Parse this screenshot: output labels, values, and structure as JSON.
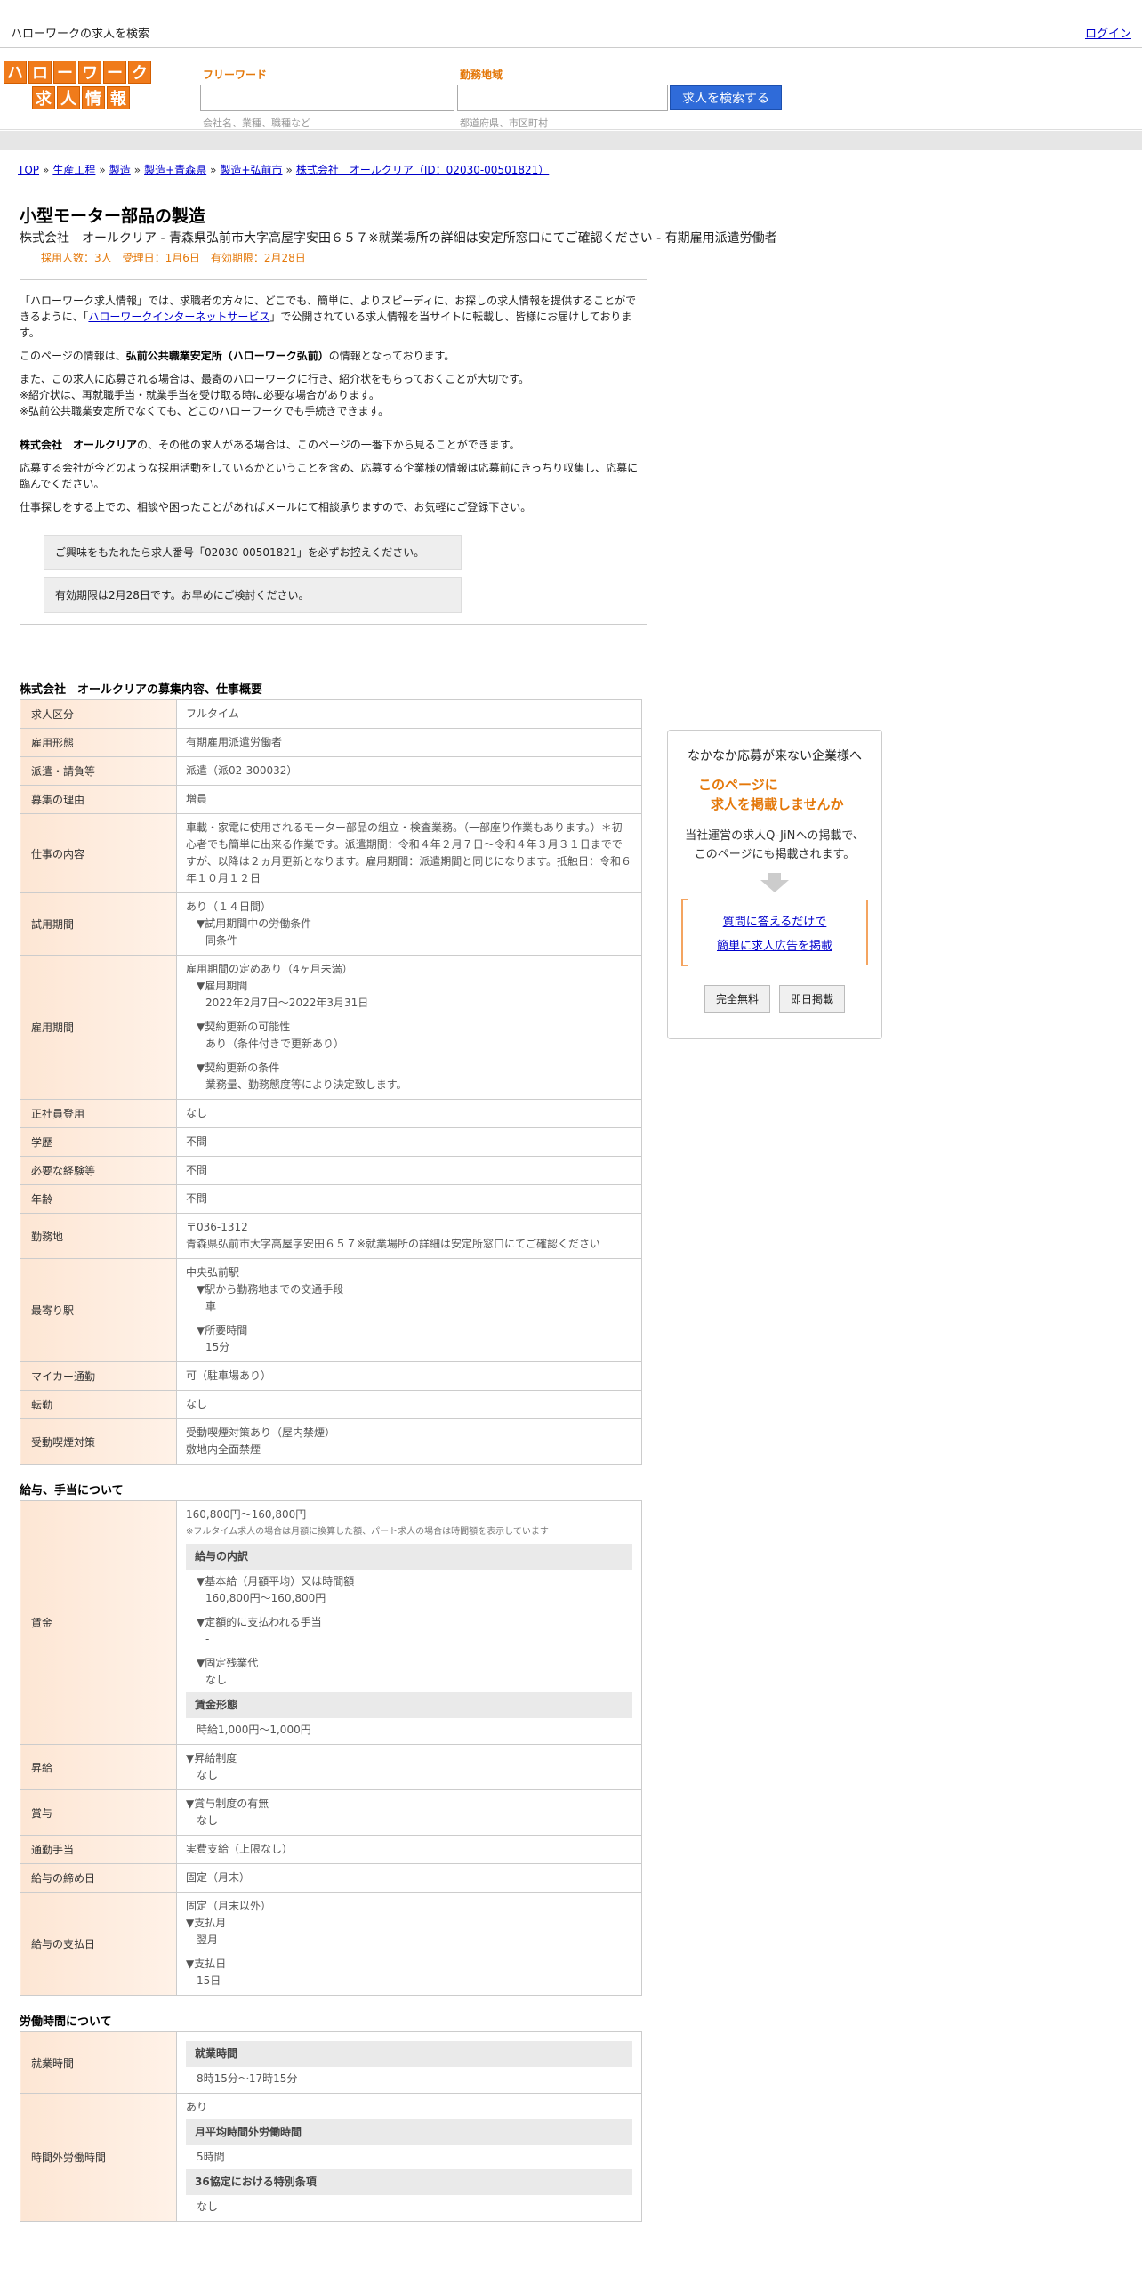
{
  "header": {
    "site_title": "ハローワークの求人を検索",
    "login": "ログイン"
  },
  "logo": {
    "row1": [
      "ハ",
      "ロ",
      "ー",
      "ワ",
      "ー",
      "ク"
    ],
    "row2": [
      "求",
      "人",
      "情",
      "報"
    ]
  },
  "search": {
    "freeword_label": "フリーワード",
    "freeword_value": "",
    "freeword_hint": "会社名、業種、職種など",
    "area_label": "勤務地域",
    "area_value": "",
    "area_hint": "都道府県、市区町村",
    "button": "求人を検索する"
  },
  "breadcrumb": [
    "TOP",
    "生産工程",
    "製造",
    "製造+青森県",
    "製造+弘前市",
    "株式会社　オールクリア（ID：02030-00501821）"
  ],
  "job": {
    "title": "小型モーター部品の製造",
    "company_line": "株式会社　オールクリア - 青森県弘前市大字高屋字安田６５７※就業場所の詳細は安定所窓口にてご確認ください - 有期雇用派遣労働者",
    "meta": "採用人数：3人　受理日：1月6日　有効期限：2月28日"
  },
  "intro": {
    "p1_a": "「ハローワーク求人情報」では、求職者の方々に、どこでも、簡単に、よりスピーディに、お探しの求人情報を提供することができるように、「",
    "p1_link": "ハローワークインターネットサービス",
    "p1_b": "」で公開されている求人情報を当サイトに転載し、皆様にお届けしております。",
    "p2_a": "このページの情報は、",
    "p2_bold": "弘前公共職業安定所（ハローワーク弘前）",
    "p2_b": "の情報となっております。",
    "p3_1": "また、この求人に応募される場合は、最寄のハローワークに行き、紹介状をもらっておくことが大切です。",
    "p3_2": "※紹介状は、再就職手当・就業手当を受け取る時に必要な場合があります。",
    "p3_3": "※弘前公共職業安定所でなくても、どこのハローワークでも手続きできます。",
    "p4_bold": "株式会社　オールクリア",
    "p4_b": "の、その他の求人がある場合は、このページの一番下から見ることができます。",
    "p5": "応募する会社が今どのような採用活動をしているかということを含め、応募する企業様の情報は応募前にきっちり収集し、応募に臨んでください。",
    "p6": "仕事探しをする上での、相談や困ったことがあればメールにて相談承りますので、お気軽にご登録下さい。"
  },
  "notices": [
    "ご興味をもたれたら求人番号「02030-00501821」を必ずお控えください。",
    "有効期限は2月28日です。お早めにご検討ください。"
  ],
  "section1": {
    "title": "株式会社　オールクリアの募集内容、仕事概要",
    "rows": [
      {
        "label": "求人区分",
        "value": "フルタイム"
      },
      {
        "label": "雇用形態",
        "value": "有期雇用派遣労働者"
      },
      {
        "label": "派遣・請負等",
        "value": "派遣（派02-300032）"
      },
      {
        "label": "募集の理由",
        "value": "増員"
      },
      {
        "label": "仕事の内容",
        "value": "車載・家電に使用されるモーター部品の組立・検査業務。（一部座り作業もあります。）＊初心者でも簡単に出来る作業です。派遣期間：令和４年２月７日～令和４年３月３１日までですが、以降は２ヵ月更新となります。雇用期間：派遣期間と同じになります。抵触日：令和６年１０月１２日"
      },
      {
        "label": "正社員登用",
        "value": "なし"
      },
      {
        "label": "学歴",
        "value": "不問"
      },
      {
        "label": "必要な経験等",
        "value": "不問"
      },
      {
        "label": "年齢",
        "value": "不問"
      },
      {
        "label": "マイカー通勤",
        "value": "可（駐車場あり）"
      },
      {
        "label": "転勤",
        "value": "なし"
      }
    ],
    "trial": {
      "label": "試用期間",
      "v1": "あり（１４日間）",
      "v2": "▼試用期間中の労働条件",
      "v3": "同条件"
    },
    "period": {
      "label": "雇用期間",
      "v1": "雇用期間の定めあり（4ヶ月未満）",
      "v2": "▼雇用期間",
      "v3": "2022年2月7日〜2022年3月31日",
      "v4": "▼契約更新の可能性",
      "v5": "あり（条件付きで更新あり）",
      "v6": "▼契約更新の条件",
      "v7": "業務量、勤務態度等により決定致します。"
    },
    "location": {
      "label": "勤務地",
      "v1": "〒036-1312",
      "v2": "青森県弘前市大字高屋字安田６５７※就業場所の詳細は安定所窓口にてご確認ください"
    },
    "station": {
      "label": "最寄り駅",
      "v1": "中央弘前駅",
      "v2": "▼駅から勤務地までの交通手段",
      "v3": "車",
      "v4": "▼所要時間",
      "v5": "15分"
    },
    "smoking": {
      "label": "受動喫煙対策",
      "v1": "受動喫煙対策あり（屋内禁煙）",
      "v2": "敷地内全面禁煙"
    }
  },
  "section2": {
    "title": "給与、手当について",
    "wage": {
      "label": "賃金",
      "v1": "160,800円〜160,800円",
      "note": "※フルタイム求人の場合は月額に換算した額、パート求人の場合は時間額を表示しています",
      "breakdown": "給与の内訳",
      "b1": "▼基本給（月額平均）又は時間額",
      "b2": "160,800円〜160,800円",
      "b3": "▼定額的に支払われる手当",
      "b4": "-",
      "b5": "▼固定残業代",
      "b6": "なし",
      "form": "賃金形態",
      "form_v": "時給1,000円〜1,000円"
    },
    "raise": {
      "label": "昇給",
      "v1": "▼昇給制度",
      "v2": "なし"
    },
    "bonus": {
      "label": "賞与",
      "v1": "▼賞与制度の有無",
      "v2": "なし"
    },
    "commute": {
      "label": "通勤手当",
      "value": "実費支給（上限なし）"
    },
    "closing": {
      "label": "給与の締め日",
      "value": "固定（月末）"
    },
    "payday": {
      "label": "給与の支払日",
      "v1": "固定（月末以外）",
      "v2": "▼支払月",
      "v3": "翌月",
      "v4": "▼支払日",
      "v5": "15日"
    }
  },
  "section3": {
    "title": "労働時間について",
    "hours": {
      "label": "就業時間",
      "head": "就業時間",
      "value": "8時15分〜17時15分"
    },
    "overtime": {
      "label": "時間外労働時間",
      "v1": "あり",
      "head1": "月平均時間外労働時間",
      "v2": "5時間",
      "head2": "36協定における特別条項",
      "v3": "なし"
    }
  },
  "sidebox": {
    "title": "なかなか応募が来ない企業様へ",
    "hl1": "このページに",
    "hl2": "求人を掲載しませんか",
    "desc1": "当社運営の求人Q-JiNへの掲載で、",
    "desc2": "このページにも掲載されます。",
    "link1": "質問に答えるだけで",
    "link2": "簡単に求人広告を掲載",
    "btn1": "完全無料",
    "btn2": "即日掲載"
  }
}
